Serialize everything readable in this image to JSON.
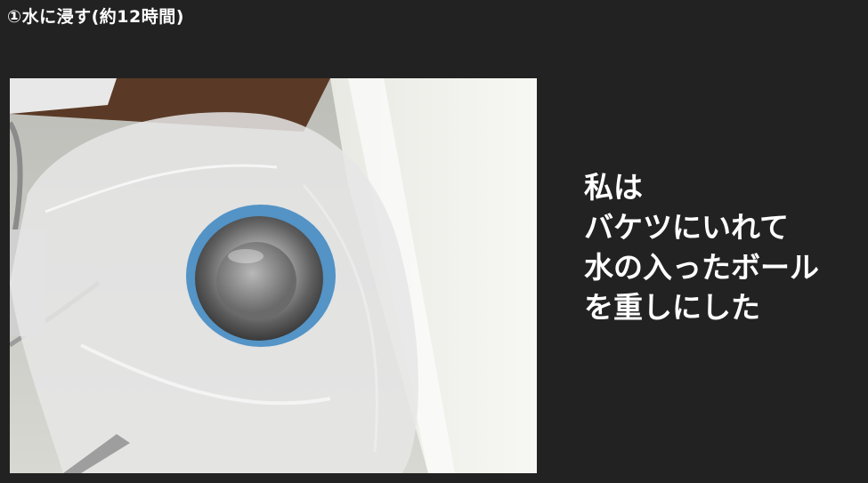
{
  "slide": {
    "title": "①水に浸す(約12時間)"
  },
  "photo": {
    "subject": "bucket-with-bowl-photo"
  },
  "caption": {
    "lines": [
      "私は",
      "バケツにいれて",
      "水の入ったボール",
      "を重しにした"
    ]
  },
  "colors": {
    "background": "#222222",
    "text": "#ffffff"
  }
}
